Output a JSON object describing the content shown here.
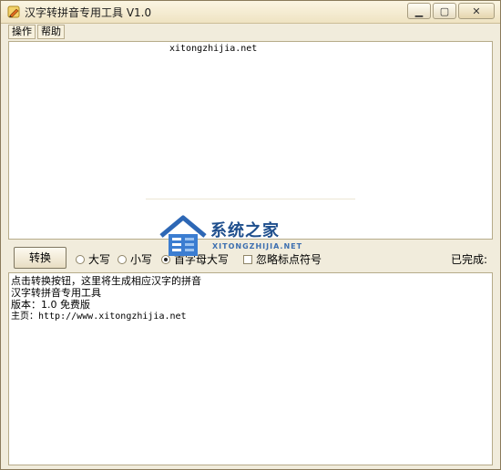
{
  "window": {
    "title": "汉字转拼音专用工具 V1.0"
  },
  "menubar": {
    "items": [
      {
        "label": "操作"
      },
      {
        "label": "帮助"
      }
    ]
  },
  "top_textarea": {
    "content": "xitongzhijia.net"
  },
  "toolbar": {
    "convert_label": "转换",
    "options": [
      {
        "label": "大写",
        "checked": false
      },
      {
        "label": "小写",
        "checked": false
      },
      {
        "label": "首字母大写",
        "checked": true
      }
    ],
    "ignore_punct_label": "忽略标点符号",
    "status_label": "已完成:"
  },
  "bottom_textarea": {
    "lines": [
      "点击转换按钮，这里将生成相应汉字的拼音",
      "",
      "",
      "汉字转拼音专用工具",
      "版本：1.0 免费版",
      "主页：http://www.xitongzhijia.net"
    ]
  },
  "watermark": {
    "brand": "系统之家",
    "url": "XITONGZHIJIA.NET"
  },
  "colors": {
    "watermark_blue": "#1f4f8d",
    "window_bg": "#f1ecdc"
  }
}
